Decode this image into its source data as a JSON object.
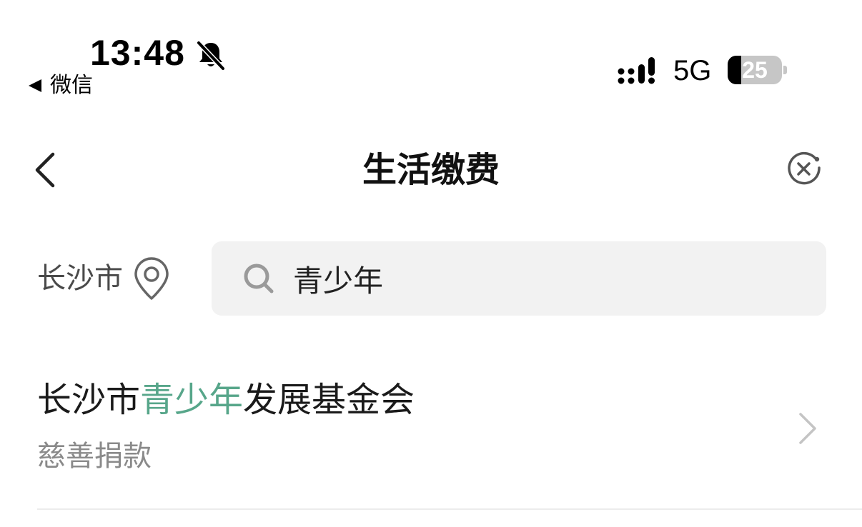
{
  "status_bar": {
    "time": "13:48",
    "back_app_label": "微信",
    "network": "5G",
    "battery_level": "25",
    "battery_fraction": 0.25,
    "icons": [
      "bell-slash-icon",
      "signal-icon",
      "battery-icon"
    ]
  },
  "nav": {
    "title": "生活缴费",
    "icons": [
      "chevron-left-icon",
      "close-circle-icon"
    ]
  },
  "search": {
    "city": "长沙市",
    "query": "青少年",
    "icons": [
      "location-pin-icon",
      "search-icon"
    ]
  },
  "results": [
    {
      "title_prefix": "长沙市",
      "title_highlight": "青少年",
      "title_suffix": "发展基金会",
      "subtitle": "慈善捐款"
    }
  ],
  "colors": {
    "highlight": "#57a68a",
    "search_bg": "#f2f2f2",
    "subtitle": "#8a8a8a"
  }
}
